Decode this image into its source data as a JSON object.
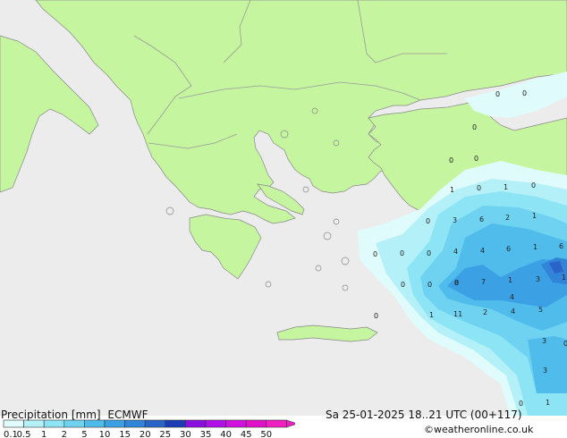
{
  "map": {
    "colors": {
      "land": "#c6f5a0",
      "sea": "#ececec",
      "border": "#9a9a9a",
      "coast": "#888888"
    },
    "precip_values": [
      {
        "label": "0"
      },
      {
        "label": "0"
      },
      {
        "label": "0"
      },
      {
        "label": "0"
      },
      {
        "label": "0"
      },
      {
        "label": "0"
      },
      {
        "label": "1"
      },
      {
        "label": "0"
      },
      {
        "label": "1"
      },
      {
        "label": "0"
      },
      {
        "label": "0"
      },
      {
        "label": "3"
      },
      {
        "label": "6"
      },
      {
        "label": "2"
      },
      {
        "label": "1"
      },
      {
        "label": "0"
      },
      {
        "label": "0"
      },
      {
        "label": "4"
      },
      {
        "label": "4"
      },
      {
        "label": "6"
      },
      {
        "label": "1"
      },
      {
        "label": "6"
      },
      {
        "label": "0"
      },
      {
        "label": "0"
      },
      {
        "label": "0"
      },
      {
        "label": "8"
      },
      {
        "label": "7"
      },
      {
        "label": "1"
      },
      {
        "label": "3"
      },
      {
        "label": "1"
      },
      {
        "label": "0"
      },
      {
        "label": "4"
      },
      {
        "label": "1"
      },
      {
        "label": "11"
      },
      {
        "label": "2"
      },
      {
        "label": "4"
      },
      {
        "label": "5"
      },
      {
        "label": "0"
      },
      {
        "label": "3"
      },
      {
        "label": "3"
      },
      {
        "label": "0"
      },
      {
        "label": "1"
      }
    ]
  },
  "footer": {
    "title": "Precipitation [mm]",
    "model": "ECMWF",
    "datetime": "Sa 25-01-2025 18..21 UTC (00+117)",
    "credit": "©weatheronline.co.uk",
    "legend": {
      "labels": [
        "0.1",
        "0.5",
        "1",
        "2",
        "5",
        "10",
        "15",
        "20",
        "25",
        "30",
        "35",
        "40",
        "45",
        "50"
      ],
      "colors": [
        "#e0fbfb",
        "#b4f0f8",
        "#8de4f4",
        "#6ed2f0",
        "#50bcec",
        "#3ca0e4",
        "#3284d8",
        "#2a64c8",
        "#1a3cb4",
        "#8a10e0",
        "#b010e8",
        "#d010e0",
        "#e010c8",
        "#f020c0"
      ]
    }
  }
}
